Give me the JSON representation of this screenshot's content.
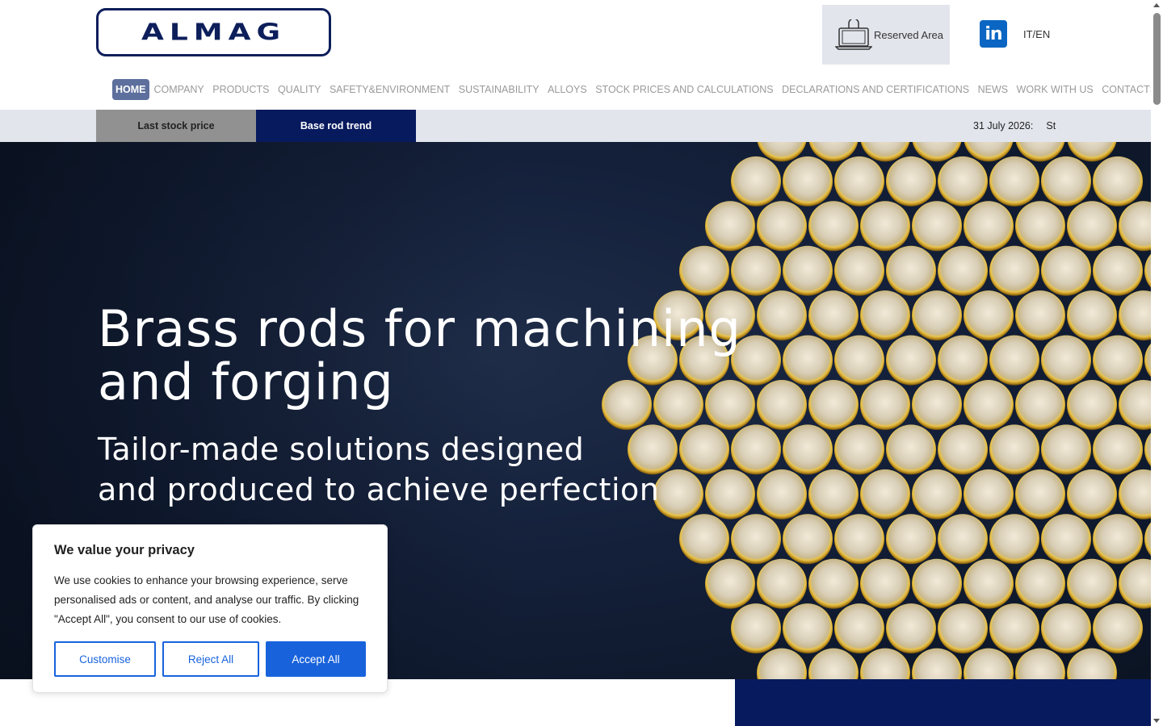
{
  "header": {
    "logo_text": "ALMAG",
    "reserved_area": "Reserved Area",
    "linkedin_label": "in",
    "language": "IT/EN"
  },
  "nav": {
    "items": [
      {
        "label": "HOME",
        "active": true
      },
      {
        "label": "COMPANY"
      },
      {
        "label": "PRODUCTS"
      },
      {
        "label": "QUALITY"
      },
      {
        "label": "SAFETY&ENVIRONMENT"
      },
      {
        "label": "SUSTAINABILITY"
      },
      {
        "label": "ALLOYS"
      },
      {
        "label": "STOCK PRICES AND CALCULATIONS"
      },
      {
        "label": "DECLARATIONS AND CERTIFICATIONS"
      },
      {
        "label": "NEWS"
      },
      {
        "label": "WORK WITH US"
      },
      {
        "label": "CONTACTS"
      }
    ]
  },
  "stock_bar": {
    "last_stock_price": "Last stock price",
    "base_rod_trend": "Base rod trend",
    "ticker_date": "31 July 2026:",
    "ticker_text": "Sto"
  },
  "hero": {
    "title_line1": "Brass rods for machining",
    "title_line2": "and forging",
    "subtitle_line1": "Tailor-made solutions designed",
    "subtitle_line2": "and produced to achieve perfection"
  },
  "cookie": {
    "title": "We value your privacy",
    "text": "We use cookies to enhance your browsing experience, serve personalised ads or content, and analyse our traffic. By clicking \"Accept All\", you consent to our use of cookies.",
    "customise": "Customise",
    "reject": "Reject All",
    "accept": "Accept All"
  },
  "colors": {
    "brand_navy": "#081a5e",
    "active_nav": "#5d6f9c",
    "cookie_accent": "#1863dc",
    "brass": "#d4a827"
  }
}
